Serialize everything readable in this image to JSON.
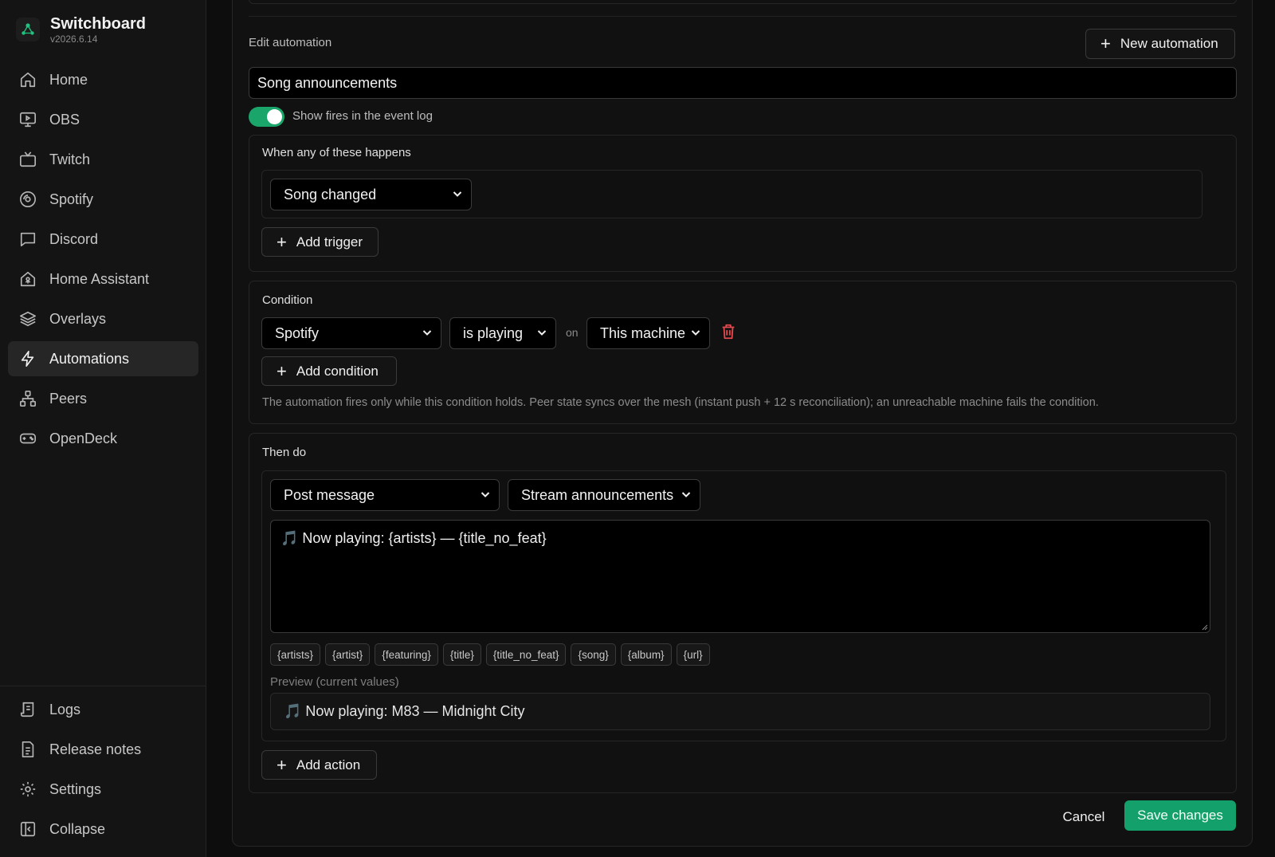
{
  "app": {
    "name": "Switchboard",
    "version": "v2026.6.14"
  },
  "nav": {
    "items": [
      {
        "label": "Home",
        "icon": "home-icon"
      },
      {
        "label": "OBS",
        "icon": "monitor-icon"
      },
      {
        "label": "Twitch",
        "icon": "tv-icon"
      },
      {
        "label": "Spotify",
        "icon": "disc-icon"
      },
      {
        "label": "Discord",
        "icon": "chat-icon"
      },
      {
        "label": "Home Assistant",
        "icon": "smart-home-icon"
      },
      {
        "label": "Overlays",
        "icon": "layers-icon"
      },
      {
        "label": "Automations",
        "icon": "bolt-icon",
        "active": true
      },
      {
        "label": "Peers",
        "icon": "network-icon"
      },
      {
        "label": "OpenDeck",
        "icon": "gamepad-icon"
      }
    ],
    "bottom": [
      {
        "label": "Logs",
        "icon": "logs-icon"
      },
      {
        "label": "Release notes",
        "icon": "document-icon"
      },
      {
        "label": "Settings",
        "icon": "gear-icon"
      },
      {
        "label": "Collapse",
        "icon": "collapse-icon"
      }
    ]
  },
  "editor": {
    "title": "Edit automation",
    "new_button": "New automation",
    "name_value": "Song announcements",
    "show_fires_label": "Show fires in the event log",
    "show_fires_on": true
  },
  "triggers": {
    "heading": "When any of these happens",
    "selected": "Song changed",
    "add_label": "Add trigger"
  },
  "condition": {
    "heading": "Condition",
    "source": "Spotify",
    "state": "is playing",
    "on_label": "on",
    "machine": "This machine",
    "add_label": "Add condition",
    "help": "The automation fires only while this condition holds. Peer state syncs over the mesh (instant push + 12 s reconciliation); an unreachable machine fails the condition."
  },
  "actions": {
    "heading": "Then do",
    "type": "Post message",
    "target": "Stream announcements",
    "message": "🎵 Now playing: {artists} — {title_no_feat}",
    "variables": [
      "{artists}",
      "{artist}",
      "{featuring}",
      "{title}",
      "{title_no_feat}",
      "{song}",
      "{album}",
      "{url}"
    ],
    "preview_label": "Preview (current values)",
    "preview_value": "🎵 Now playing: M83 — Midnight City",
    "add_label": "Add action"
  },
  "footer": {
    "cancel": "Cancel",
    "save": "Save changes"
  },
  "colors": {
    "accent": "#14a06a",
    "danger": "#e5484d",
    "background": "#0d0d0d",
    "sidebar": "#141414"
  }
}
